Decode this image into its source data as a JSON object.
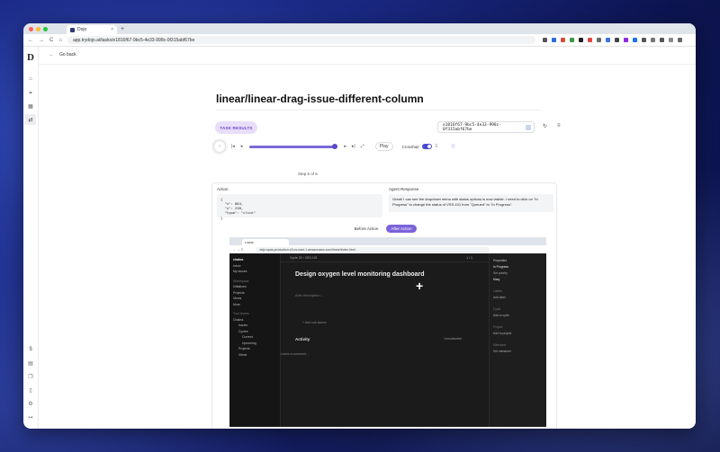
{
  "browser": {
    "tab_title": "Dojo",
    "url": "app.trydojo.ai/tasks/e1816f67-9bc5-4e33-998c-0f315abf67be",
    "new_tab": "+",
    "tab_close": "×"
  },
  "nav": {
    "back": "←",
    "forward": "→",
    "reload": "C",
    "home": "⌂"
  },
  "sidebar": {
    "logo": "D"
  },
  "page": {
    "go_back": "Go back",
    "title": "linear/linear-drag-issue-different-column",
    "task_results": "TASK RESULTS",
    "task_id": "e1816f67-9bc5-4e33-998c-0f315abf67be",
    "step_label": "Step 6 of 6",
    "play": "Play",
    "crosshair": "Crosshair",
    "step_progress": 1.0
  },
  "panel": {
    "action_label": "Action",
    "action_json": "{\n  \"x\": 884,\n  \"y\": 238,\n  \"type\": \"click\"\n}",
    "response_label": "Agent Response",
    "response_text": "Great! I can see the dropdown menu with status options is now visible. I need to click on \"In Progress\" to change the status of VSS-101 from \"Queued\" to \"In Progress\".",
    "before_btn": "Before Action",
    "after_btn": "After Action"
  },
  "inner": {
    "tab_title": "Linear",
    "url": "dojo.spas.production.s3.us-east-1.amazonaws.com/linear/index.html",
    "workspace": "chakra",
    "cycle_crumb": "Cycle 20  ›  VSS-101",
    "pager": "1 / 1",
    "issue_title": "Design oxygen level monitoring dashboard",
    "description_placeholder": "Add description...",
    "add_sub": "+ Add sub-issues",
    "activity": "Activity",
    "unsubscribe": "Unsubscribe",
    "comment_placeholder": "Leave a comment...",
    "side_items": [
      "Inbox",
      "My issues",
      "Workspace",
      "Initiatives",
      "Projects",
      "Views",
      "More",
      "Your teams",
      "Chakra",
      "Issues",
      "Cycles",
      "Current",
      "Upcoming",
      "Projects",
      "Views"
    ],
    "props_title": "Properties",
    "props": [
      "In Progress",
      "Set priority",
      "Mary"
    ],
    "labels_title": "Labels",
    "add_label": "Add label",
    "cycle_title": "Cycle",
    "add_cycle": "Add to cycle",
    "project_title": "Project",
    "add_project": "Add to project",
    "milestone_title": "Milestone",
    "set_milestone": "Set milestone"
  },
  "colors": {
    "accent": "#7b63d9",
    "task_badge_bg": "#e9defa",
    "toggle": "#4a4ad0"
  }
}
